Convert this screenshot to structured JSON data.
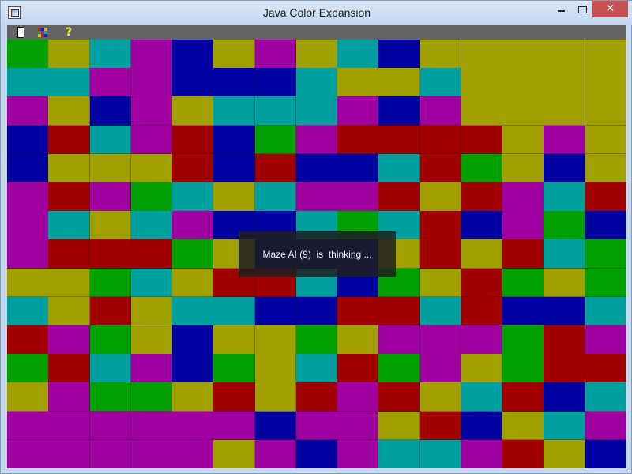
{
  "window": {
    "title": "Java Color Expansion",
    "close_label": "✕"
  },
  "toolbar": {
    "items": [
      "new-game-icon",
      "colors-icon",
      "help-icon"
    ],
    "help_label": "?"
  },
  "status": {
    "message": "Maze AI (9)  is  thinking ..."
  },
  "colors": {
    "G": "#00a000",
    "O": "#a0a000",
    "C": "#00a0a0",
    "M": "#a000a0",
    "B": "#0000a0",
    "R": "#a00000"
  },
  "board": {
    "cols": 15,
    "rows": 15,
    "grid": [
      "GOCMBOMOCBOOOOO",
      "CCMMBBBCOOCOOOO",
      "MOBMOCCCMBMOOOO",
      "BRCMRBGMRRRROMO",
      "BOOORBRBBCRGOBO",
      "MRMGCOCMMRORMCR",
      "MCOCMBBCGCRBMGB",
      "MRRRGOBBBORORCG",
      "OOGCORRCBGORGOG",
      "COROCCBBRRCRBBC",
      "RMGOBOOGOMMMGRM",
      "GRCMBGOCRGMOGRR",
      "OMGGORORMROCRBC",
      "MMMMMMBMMORBOCM",
      "MMMMMOMBMCCMROB"
    ]
  }
}
